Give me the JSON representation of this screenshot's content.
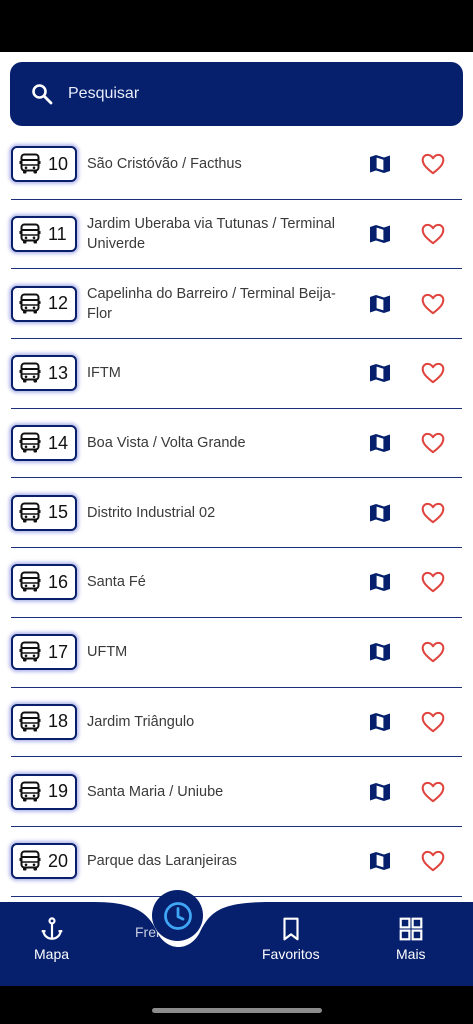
{
  "search": {
    "placeholder": "Pesquisar"
  },
  "routes": [
    {
      "number": "10",
      "name": "São Cristóvão / Facthus"
    },
    {
      "number": "11",
      "name": "Jardim Uberaba via Tutunas / Terminal Univerde"
    },
    {
      "number": "12",
      "name": "Capelinha do Barreiro / Terminal Beija-Flor"
    },
    {
      "number": "13",
      "name": "IFTM"
    },
    {
      "number": "14",
      "name": "Boa Vista / Volta Grande"
    },
    {
      "number": "15",
      "name": "Distrito Industrial 02"
    },
    {
      "number": "16",
      "name": "Santa Fé"
    },
    {
      "number": "17",
      "name": "UFTM"
    },
    {
      "number": "18",
      "name": "Jardim Triângulo"
    },
    {
      "number": "19",
      "name": "Santa Maria / Uniube"
    },
    {
      "number": "20",
      "name": "Parque das Laranjeiras"
    }
  ],
  "nav": {
    "map_label": "Mapa",
    "peek_label": "Frei",
    "favorites_label": "Favoritos",
    "more_label": "Mais"
  },
  "colors": {
    "primary": "#06206e",
    "accent": "#3fa7f5",
    "heart": "#e0443e",
    "background": "#ffffff"
  },
  "icons": {
    "search": "search-icon",
    "bus": "bus-icon",
    "map": "map-icon",
    "favorite": "heart-outline-icon",
    "nav_map": "anchor-icon",
    "clock": "clock-icon",
    "bookmark": "bookmark-icon",
    "grid": "grid-icon"
  }
}
